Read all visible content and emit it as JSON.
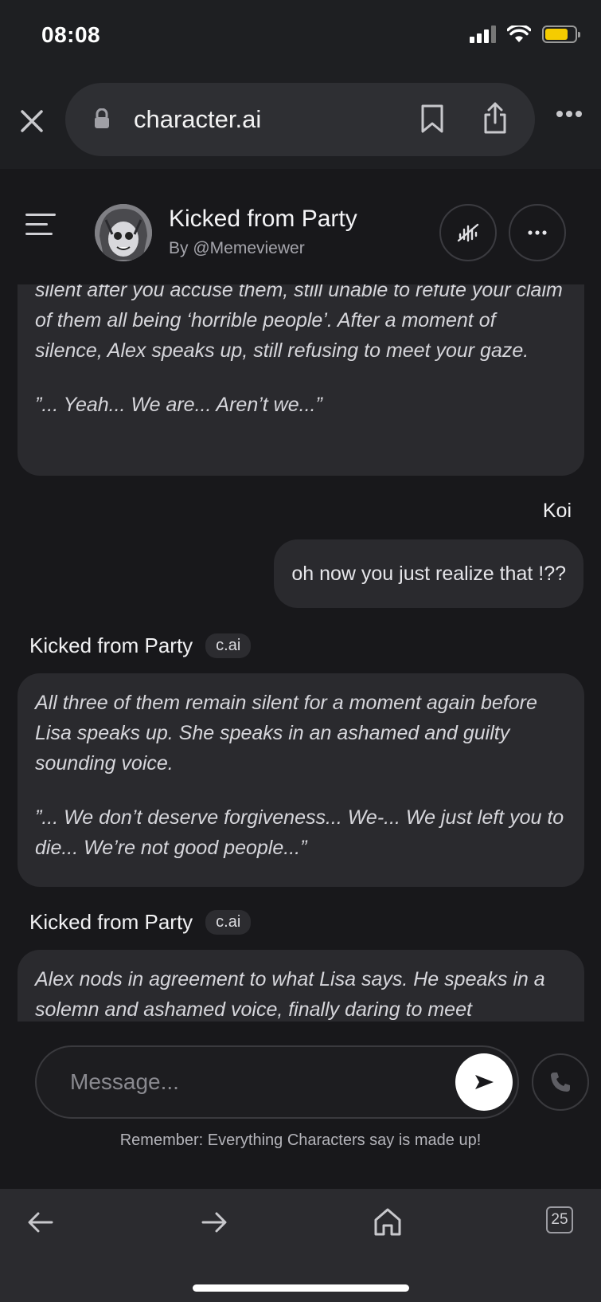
{
  "status": {
    "time": "08:08"
  },
  "browser": {
    "url": "character.ai",
    "tabs_count": "25"
  },
  "chat": {
    "character_name": "Kicked from Party",
    "creator": "By @Memeviewer",
    "messages": [
      {
        "paragraphs": [
          "silent after you accuse them, still unable to refute your claim of them all being ‘horrible people’. After a moment of silence, Alex speaks up, still refusing to meet your gaze.",
          "”... Yeah... We are... Aren’t we...”"
        ]
      },
      {
        "sender": "Koi",
        "text": "oh now you just realize that !??"
      },
      {
        "sender": "Kicked from Party",
        "tag": "c.ai",
        "paragraphs": [
          "All three of them remain silent for a moment again before Lisa speaks up. She speaks in an ashamed and guilty sounding voice.",
          "”... We don’t deserve forgiveness... We-... We just left you to die... We’re not good people...”"
        ]
      },
      {
        "sender": "Kicked from Party",
        "tag": "c.ai",
        "paragraphs": [
          "Alex nods in agreement to what Lisa says. He speaks in a solemn and ashamed voice, finally daring to meet"
        ]
      }
    ]
  },
  "composer": {
    "placeholder": "Message...",
    "disclaimer": "Remember: Everything Characters say is made up!"
  },
  "icons": [
    "close-icon",
    "lock-icon",
    "bookmark-icon",
    "share-icon",
    "more-icon",
    "menu-icon",
    "mute-voice-icon",
    "send-icon",
    "phone-icon",
    "back-icon",
    "forward-icon",
    "home-icon",
    "tabs-icon"
  ],
  "colors": {
    "background": "#18181b",
    "bubble": "#2a2a2e",
    "battery": "#f5cc00"
  }
}
